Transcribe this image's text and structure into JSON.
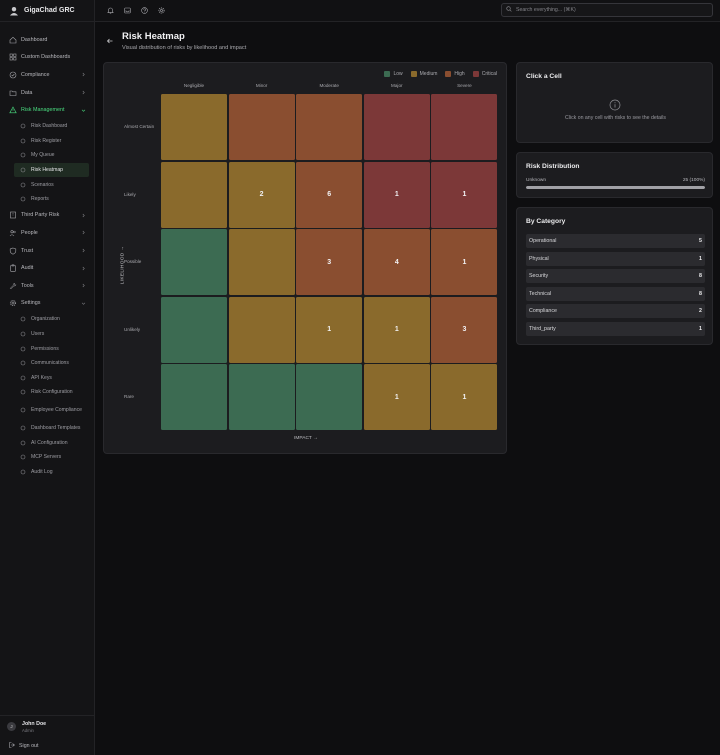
{
  "app": {
    "name": "GigaChad GRC"
  },
  "sidebar": {
    "items": [
      {
        "label": "Dashboard",
        "icon": "home-icon"
      },
      {
        "label": "Custom Dashboards",
        "icon": "grid-icon"
      },
      {
        "label": "Compliance",
        "icon": "check-circle-icon",
        "chevron": "right"
      },
      {
        "label": "Data",
        "icon": "folder-icon",
        "chevron": "right"
      },
      {
        "label": "Risk Management",
        "icon": "warning-triangle-icon",
        "chevron": "down",
        "active": true
      }
    ],
    "risk_sub": [
      {
        "label": "Risk Dashboard"
      },
      {
        "label": "Risk Register"
      },
      {
        "label": "My Queue"
      },
      {
        "label": "Risk Heatmap",
        "current": true
      },
      {
        "label": "Scenarios"
      },
      {
        "label": "Reports"
      }
    ],
    "items_after": [
      {
        "label": "Third Party Risk",
        "icon": "building-icon",
        "chevron": "right"
      },
      {
        "label": "People",
        "icon": "people-icon",
        "chevron": "right"
      },
      {
        "label": "Trust",
        "icon": "shield-icon",
        "chevron": "right"
      },
      {
        "label": "Audit",
        "icon": "clipboard-icon",
        "chevron": "right"
      },
      {
        "label": "Tools",
        "icon": "wrench-icon",
        "chevron": "right"
      },
      {
        "label": "Settings",
        "icon": "gear-icon",
        "chevron": "down"
      }
    ],
    "settings_sub": [
      {
        "label": "Organization"
      },
      {
        "label": "Users"
      },
      {
        "label": "Permissions"
      },
      {
        "label": "Communications"
      },
      {
        "label": "API Keys"
      },
      {
        "label": "Risk Configuration"
      },
      {
        "label": "Employee Compliance"
      },
      {
        "label": "Dashboard Templates"
      },
      {
        "label": "AI Configuration"
      },
      {
        "label": "MCP Servers"
      },
      {
        "label": "Audit Log"
      }
    ],
    "user": {
      "initial": "J",
      "name": "John Doe",
      "role": "Admin"
    },
    "signout": "Sign out"
  },
  "topbar": {
    "search_placeholder": "Search everything... (⌘K)"
  },
  "page": {
    "title": "Risk Heatmap",
    "subtitle": "Visual distribution of risks by likelihood and impact"
  },
  "heatmap": {
    "legend": [
      {
        "label": "Low",
        "color": "#3c6b52"
      },
      {
        "label": "Medium",
        "color": "#8a6a2c"
      },
      {
        "label": "High",
        "color": "#8a4e30"
      },
      {
        "label": "Critical",
        "color": "#7c3838"
      }
    ],
    "columns": [
      "Negligible",
      "Minor",
      "Moderate",
      "Major",
      "Severe"
    ],
    "rows": [
      "Almost Certain",
      "Likely",
      "Possible",
      "Unlikely",
      "Rare"
    ],
    "y_axis": "LIKELIHOOD →",
    "x_axis": "IMPACT →",
    "levels": [
      [
        "medium",
        "high",
        "high",
        "critical",
        "critical"
      ],
      [
        "medium",
        "medium",
        "high",
        "critical",
        "critical"
      ],
      [
        "low",
        "medium",
        "high",
        "high",
        "high"
      ],
      [
        "low",
        "medium",
        "medium",
        "medium",
        "high"
      ],
      [
        "low",
        "low",
        "low",
        "medium",
        "medium"
      ]
    ],
    "counts": [
      [
        "",
        "",
        "",
        "",
        ""
      ],
      [
        "",
        "2",
        "6",
        "1",
        "1"
      ],
      [
        "",
        "",
        "3",
        "4",
        "1"
      ],
      [
        "",
        "",
        "1",
        "1",
        "3"
      ],
      [
        "",
        "",
        "",
        "1",
        "1"
      ]
    ]
  },
  "click_card": {
    "title": "Click a Cell",
    "message": "Click on any cell with risks to see the details"
  },
  "distribution": {
    "title": "Risk Distribution",
    "label": "Unknown",
    "value": "25 (100%)",
    "fraction": 1.0
  },
  "categories": {
    "title": "By Category",
    "items": [
      {
        "label": "Operational",
        "count": "5"
      },
      {
        "label": "Physical",
        "count": "1"
      },
      {
        "label": "Security",
        "count": "8"
      },
      {
        "label": "Technical",
        "count": "8"
      },
      {
        "label": "Compliance",
        "count": "2"
      },
      {
        "label": "Third_party",
        "count": "1"
      }
    ]
  }
}
